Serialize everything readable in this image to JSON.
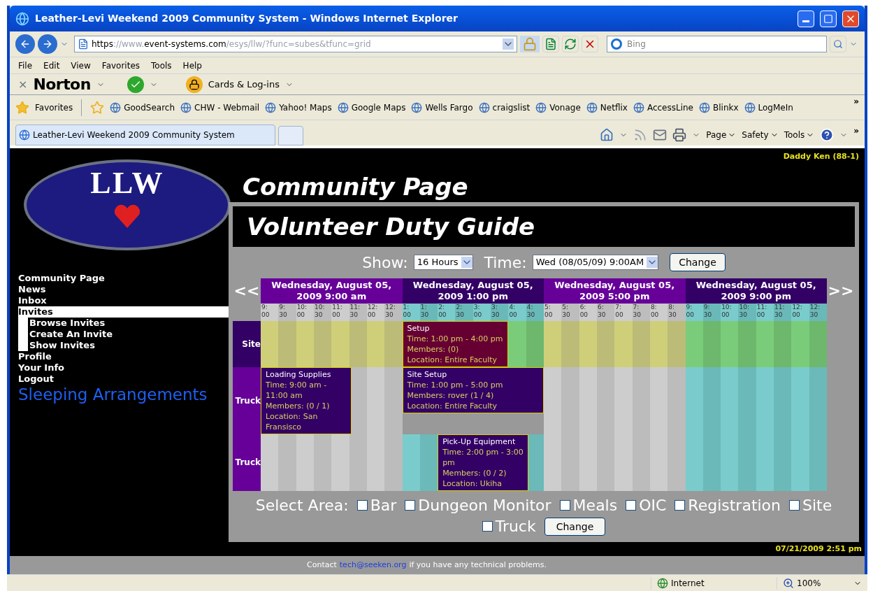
{
  "window": {
    "title": "Leather-Levi Weekend 2009 Community System - Windows Internet Explorer"
  },
  "address_bar": {
    "url_parts": [
      {
        "text": "https",
        "dim": false
      },
      {
        "text": "://www.",
        "dim": true
      },
      {
        "text": "event-systems.com",
        "dim": false
      },
      {
        "text": "/esys/llw/?func=subes&tfunc=grid",
        "dim": true
      }
    ],
    "search_placeholder": "Bing"
  },
  "menu": [
    "File",
    "Edit",
    "View",
    "Favorites",
    "Tools",
    "Help"
  ],
  "norton_bar": {
    "close": "×",
    "brand": "Norton",
    "cards": "Cards & Log-ins"
  },
  "favorites_bar": {
    "label": "Favorites",
    "links": [
      "GoodSearch",
      "CHW - Webmail",
      "Yahoo! Maps",
      "Google Maps",
      "Wells Fargo",
      "craigslist",
      "Vonage",
      "Netflix",
      "AccessLine",
      "Blinkx",
      "LogMeIn"
    ],
    "more": "»"
  },
  "tab": {
    "title": "Leather-Levi Weekend 2009 Community System"
  },
  "command_bar": {
    "menus": [
      "Page",
      "Safety",
      "Tools"
    ],
    "more": "»"
  },
  "page": {
    "user": "Daddy Ken (88-1)",
    "heading": "Community Page",
    "logo_text": "LLW",
    "nav": [
      {
        "label": "Community Page",
        "selected": false
      },
      {
        "label": "News",
        "selected": false
      },
      {
        "label": "Inbox",
        "selected": false
      },
      {
        "label": "Invites",
        "selected": true,
        "children": [
          {
            "label": "Browse Invites",
            "selected": false
          },
          {
            "label": "Create An Invite",
            "selected": false
          },
          {
            "label": "Show Invites",
            "selected": false
          }
        ]
      },
      {
        "label": "Profile",
        "selected": false
      },
      {
        "label": "Your Info",
        "selected": false
      },
      {
        "label": "Logout",
        "selected": false
      }
    ],
    "extra_link": "Sleeping Arrangements"
  },
  "guide": {
    "title": "Volunteer Duty Guide",
    "show_label": "Show:",
    "show_value": "16 Hours",
    "time_label": "Time:",
    "time_value": "Wed (08/05/09) 9:00AM",
    "change": "Change",
    "prev": "<<",
    "next": ">>",
    "days": [
      "Wednesday, August 05, 2009 9:00 am",
      "Wednesday, August 05, 2009 1:00 pm",
      "Wednesday, August 05, 2009 5:00 pm",
      "Wednesday, August 05, 2009 9:00 pm"
    ],
    "slots": [
      {
        "hour": "9:",
        "minute": "00"
      },
      {
        "hour": "9:",
        "minute": "30"
      },
      {
        "hour": "10:",
        "minute": "00"
      },
      {
        "hour": "10:",
        "minute": "30"
      },
      {
        "hour": "11:",
        "minute": "00"
      },
      {
        "hour": "11:",
        "minute": "30"
      },
      {
        "hour": "12:",
        "minute": "00"
      },
      {
        "hour": "12:",
        "minute": "30"
      },
      {
        "hour": "1:",
        "minute": "00"
      },
      {
        "hour": "1:",
        "minute": "30"
      },
      {
        "hour": "2:",
        "minute": "00"
      },
      {
        "hour": "2:",
        "minute": "30"
      },
      {
        "hour": "3:",
        "minute": "00"
      },
      {
        "hour": "3:",
        "minute": "30"
      },
      {
        "hour": "4:",
        "minute": "00"
      },
      {
        "hour": "4:",
        "minute": "30"
      },
      {
        "hour": "5:",
        "minute": "00"
      },
      {
        "hour": "5:",
        "minute": "30"
      },
      {
        "hour": "6:",
        "minute": "00"
      },
      {
        "hour": "6:",
        "minute": "30"
      },
      {
        "hour": "7:",
        "minute": "00"
      },
      {
        "hour": "7:",
        "minute": "30"
      },
      {
        "hour": "8:",
        "minute": "00"
      },
      {
        "hour": "8:",
        "minute": "30"
      },
      {
        "hour": "9:",
        "minute": "00"
      },
      {
        "hour": "9:",
        "minute": "30"
      },
      {
        "hour": "10:",
        "minute": "00"
      },
      {
        "hour": "10:",
        "minute": "30"
      },
      {
        "hour": "11:",
        "minute": "00"
      },
      {
        "hour": "11:",
        "minute": "30"
      },
      {
        "hour": "12:",
        "minute": "00"
      },
      {
        "hour": "12:",
        "minute": "30"
      }
    ],
    "rows": [
      {
        "area": "Site",
        "kind": "site",
        "events": [
          {
            "title": "Setup",
            "color": "#660033",
            "time": "Time: 1:00 pm - 4:00 pm",
            "lines": [
              "Members: (0)",
              "Location: Entire Faculty"
            ]
          }
        ]
      },
      {
        "area": "Truck",
        "kind": "truck",
        "events": [
          {
            "title": "Loading Supplies",
            "color": "#330066",
            "time": "Time: 9:00 am - 11:00 am",
            "lines": [
              "Members: (0 / 1)",
              "Location: San Fransisco"
            ]
          },
          {
            "title": "Site Setup",
            "color": "#330066",
            "time": "Time: 1:00 pm - 5:00 pm",
            "lines": [
              "Members: rover (1 / 4)",
              "Location: Entire Faculty"
            ]
          }
        ]
      },
      {
        "area": "Truck",
        "kind": "truck",
        "events": [
          {
            "title": "Pick-Up Equipment",
            "color": "#330066",
            "time": "Time: 2:00 pm - 3:00 pm",
            "lines": [
              "Members: (0 / 2)",
              "Location: Ukiha"
            ]
          }
        ]
      }
    ],
    "select_label": "Select Area:",
    "areas": [
      {
        "label": "Bar",
        "checked": false
      },
      {
        "label": "Dungeon Monitor",
        "checked": false
      },
      {
        "label": "Meals",
        "checked": false
      },
      {
        "label": "OIC",
        "checked": false
      },
      {
        "label": "Registration",
        "checked": false
      },
      {
        "label": "Site",
        "checked": false
      },
      {
        "label": "Truck",
        "checked": false
      }
    ],
    "area_change": "Change"
  },
  "footer": {
    "timestamp": "07/21/2009 2:51 pm",
    "contact_before": "Contact",
    "email": "tech@seeken.org",
    "contact_after": "if you have any technical problems."
  },
  "status_bar": {
    "zone": "Internet",
    "zoom": "100%"
  }
}
